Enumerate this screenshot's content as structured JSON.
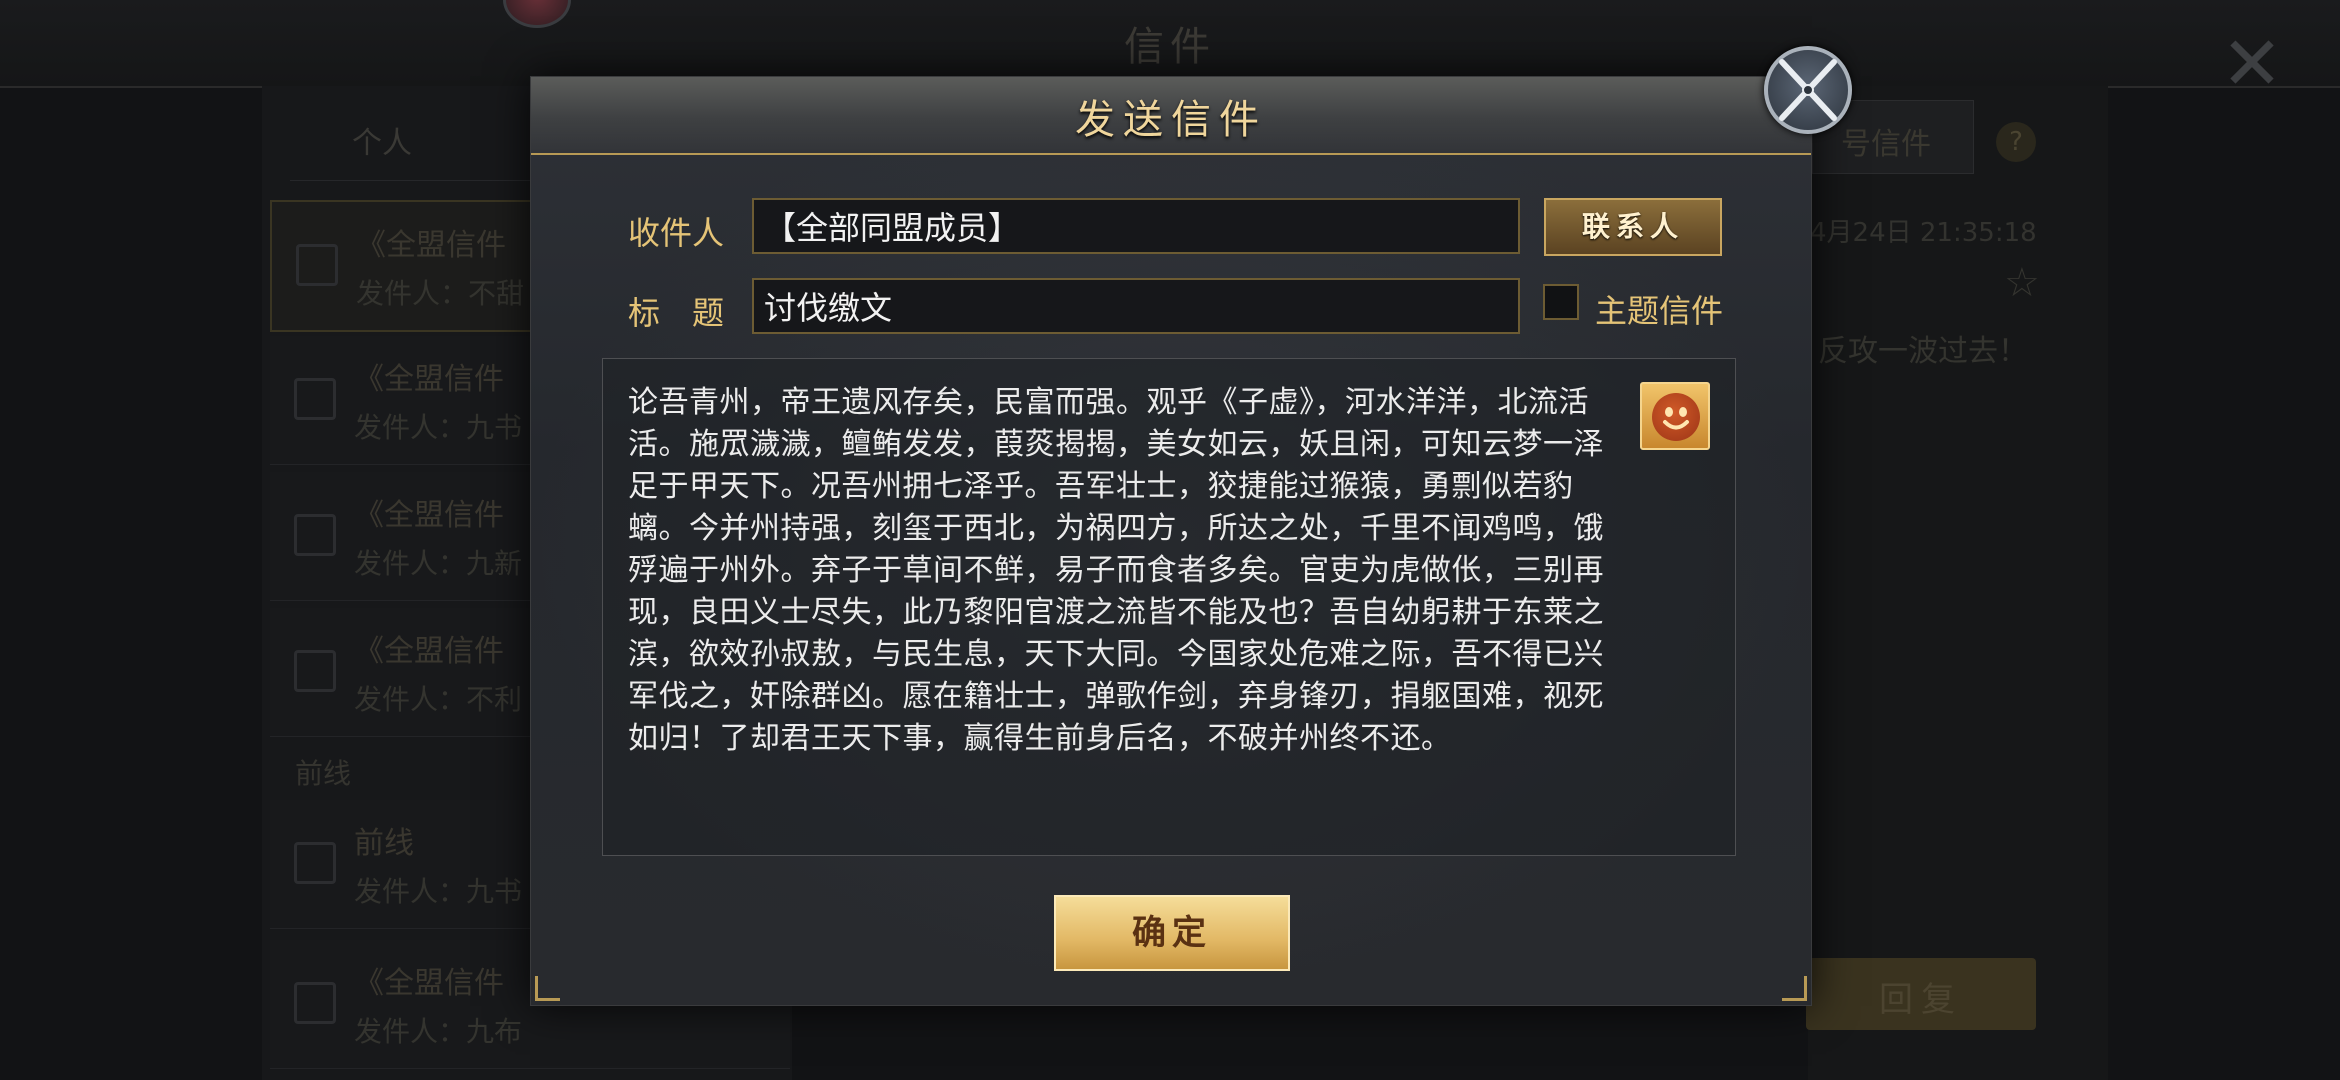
{
  "background": {
    "title": "信件",
    "left_tab": "个人",
    "items": [
      {
        "title": "《全盟信件",
        "sender": "发件人：不甜"
      },
      {
        "title": "《全盟信件",
        "sender": "发件人：九书"
      },
      {
        "title": "《全盟信件",
        "sender": "发件人：九新"
      },
      {
        "title": "《全盟信件",
        "sender": "发件人：不利"
      },
      {
        "title": "前线",
        "sender": "发件人：九书"
      },
      {
        "title": "《全盟信件",
        "sender": "发件人：九布"
      }
    ],
    "section_label": "前线",
    "right_tab": "号信件",
    "right_help": "?",
    "date": "4月24日 21:35:18",
    "star": "☆",
    "greeting": "反攻一波过去！",
    "reply_button": "回复"
  },
  "dialog": {
    "title": "发送信件",
    "recipient_label": "收件人",
    "recipient_value": "【全部同盟成员】",
    "contacts_button": "联系人",
    "subject_label": "标　题",
    "subject_value": "讨伐缴文",
    "theme_checkbox_label": "主题信件",
    "theme_checked": false,
    "body": "论吾青州，帝王遗风存矣，民富而强。观乎《子虚》，河水洋洋，北流活活。施罛濊濊，鳣鲔发发，葭菼揭揭，美女如云，妖且闲，可知云梦一泽足于甲天下。况吾州拥七泽乎。吾军壮士，狡捷能过猴猿，勇剽似若豹螭。今并州持强，刻玺于西北，为祸四方，所达之处，千里不闻鸡鸣，饿殍遍于州外。弃子于草间不鲜，易子而食者多矣。官吏为虎做伥，三别再现，良田义士尽失，此乃黎阳官渡之流皆不能及也？吾自幼躬耕于东莱之滨，欲效孙叔敖，与民生息，天下大同。今国家处危难之际，吾不得已兴军伐之，奸除群凶。愿在籍壮士，弹歌作剑，弃身锋刃，捐躯国难，视死如归！了却君王天下事，赢得生前身后名，不破并州终不还。",
    "confirm_button": "确定",
    "icons": [
      "close-icon",
      "emoji-icon"
    ]
  }
}
